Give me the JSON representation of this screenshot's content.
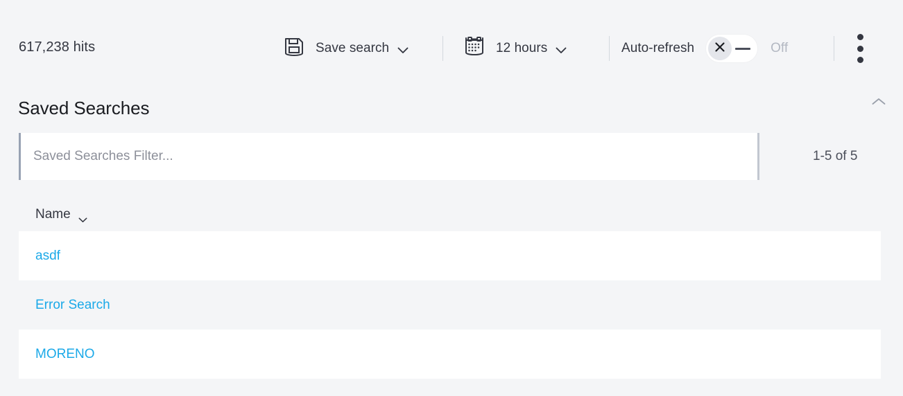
{
  "toolbar": {
    "hits": "617,238 hits",
    "save_search_label": "Save search",
    "save_search_icon": "floppy-disk-save-icon",
    "time_range_label": "12 hours",
    "time_range_icon": "calendar-icon",
    "auto_refresh_label": "Auto-refresh",
    "auto_refresh_state": "Off",
    "auto_refresh_enabled": false,
    "menu_icon": "kebab-menu-icon",
    "caret_icon": "chevron-down-icon"
  },
  "panel": {
    "title": "Saved Searches",
    "collapse_icon": "chevron-up-icon"
  },
  "filter": {
    "value": "",
    "placeholder": "Saved Searches Filter...",
    "pagination": "1-5 of 5"
  },
  "table": {
    "columns": [
      {
        "label": "Name",
        "sort_icon": "chevron-down-icon",
        "sortable": true
      }
    ],
    "rows": [
      {
        "name": "asdf"
      },
      {
        "name": "Error Search"
      },
      {
        "name": "MORENO"
      }
    ]
  },
  "colors": {
    "page_background": "#f4f5f7",
    "row_background": "#ffffff",
    "link": "#1ba9e8",
    "text": "#343741",
    "muted_text": "#8d909a",
    "disabled_text": "#b3b8c2",
    "divider": "#d3d8de"
  }
}
